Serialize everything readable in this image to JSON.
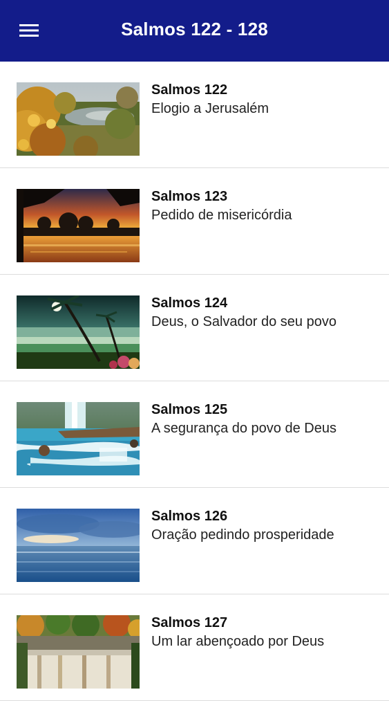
{
  "header": {
    "title": "Salmos 122 - 128",
    "background": "#131c8a",
    "menu_icon": "hamburger-menu-icon"
  },
  "items": [
    {
      "title": "Salmos 122",
      "subtitle": "Elogio a Jerusalém",
      "image": "autumn-pond-landscape"
    },
    {
      "title": "Salmos 123",
      "subtitle": "Pedido de misericórdia",
      "image": "sunset-over-lake"
    },
    {
      "title": "Salmos 124",
      "subtitle": "Deus, o Salvador do seu povo",
      "image": "moonlit-palm-beach"
    },
    {
      "title": "Salmos 125",
      "subtitle": "A segurança do povo de Deus",
      "image": "turquoise-waterfall"
    },
    {
      "title": "Salmos 126",
      "subtitle": "Oração pedindo prosperidade",
      "image": "ocean-horizon-clouds"
    },
    {
      "title": "Salmos 127",
      "subtitle": "Um lar abençoado por Deus",
      "image": "autumn-waterfall"
    }
  ]
}
